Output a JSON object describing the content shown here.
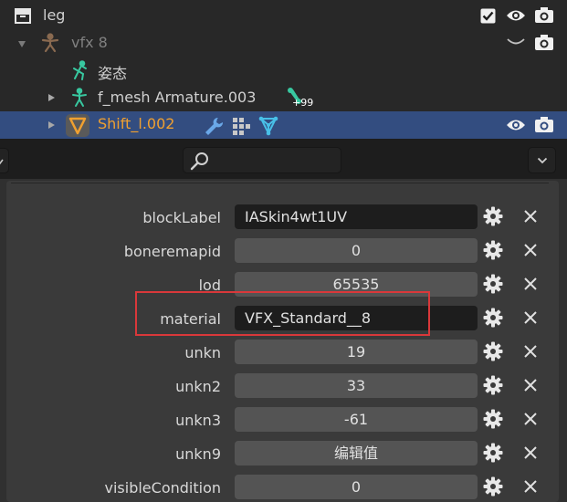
{
  "outliner": {
    "rows": [
      {
        "label": "leg"
      },
      {
        "label": "vfx 8"
      },
      {
        "label": "姿态"
      },
      {
        "label": "f_mesh Armature.003",
        "badge": "+99"
      },
      {
        "label": "Shift_l.002"
      }
    ]
  },
  "properties": {
    "search": {
      "placeholder": ""
    },
    "rows": [
      {
        "label": "blockLabel",
        "value": "IASkin4wt1UV",
        "kind": "text"
      },
      {
        "label": "boneremapid",
        "value": "0",
        "kind": "number"
      },
      {
        "label": "lod",
        "value": "65535",
        "kind": "number"
      },
      {
        "label": "material",
        "value": "VFX_Standard__8",
        "kind": "text",
        "highlighted": true
      },
      {
        "label": "unkn",
        "value": "19",
        "kind": "number"
      },
      {
        "label": "unkn2",
        "value": "33",
        "kind": "number"
      },
      {
        "label": "unkn3",
        "value": "-61",
        "kind": "number"
      },
      {
        "label": "unkn9",
        "value": "编辑值",
        "kind": "number"
      },
      {
        "label": "visibleCondition",
        "value": "0",
        "kind": "number"
      }
    ]
  },
  "colors": {
    "selection": "#334d80",
    "accent_orange": "#f0a030",
    "armature_green": "#38c8a0",
    "highlight_red": "#d9383a",
    "mesh_cyan": "#48c0e8"
  },
  "icons": [
    "collection-icon",
    "checkbox-icon",
    "eye-icon",
    "camera-icon",
    "hide-eye-icon",
    "armature-icon",
    "pose-icon",
    "bone-icon",
    "mesh-icon",
    "wrench-icon",
    "vertex-groups-icon",
    "mesh-data-icon",
    "search-icon",
    "chevron-down-icon",
    "gear-icon",
    "close-icon"
  ]
}
